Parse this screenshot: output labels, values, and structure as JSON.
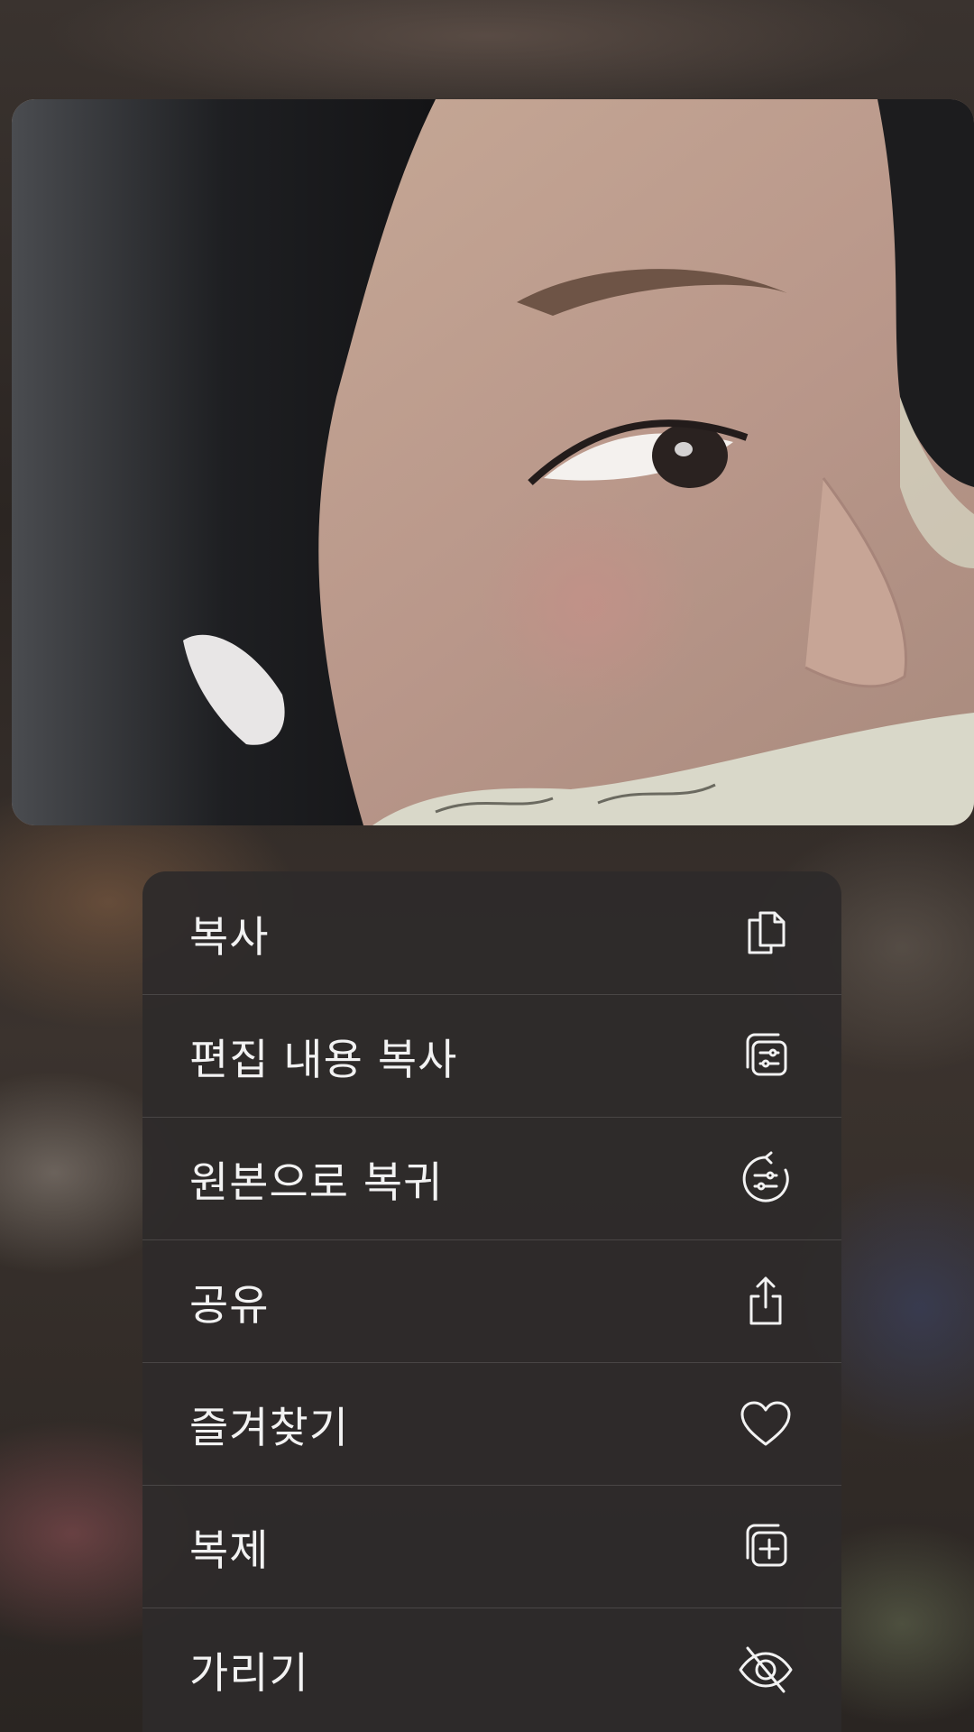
{
  "menu": {
    "items": [
      {
        "label": "복사",
        "icon": "copy-icon"
      },
      {
        "label": "편집 내용 복사",
        "icon": "copy-edits-icon"
      },
      {
        "label": "원본으로 복귀",
        "icon": "revert-to-original-icon"
      },
      {
        "label": "공유",
        "icon": "share-icon"
      },
      {
        "label": "즐겨찾기",
        "icon": "heart-icon"
      },
      {
        "label": "복제",
        "icon": "duplicate-icon"
      },
      {
        "label": "가리기",
        "icon": "hide-eye-slash-icon"
      }
    ]
  },
  "colors": {
    "menu_background": "#2e2b2b",
    "menu_text": "#f2f2f2",
    "separator": "#4a4646"
  }
}
